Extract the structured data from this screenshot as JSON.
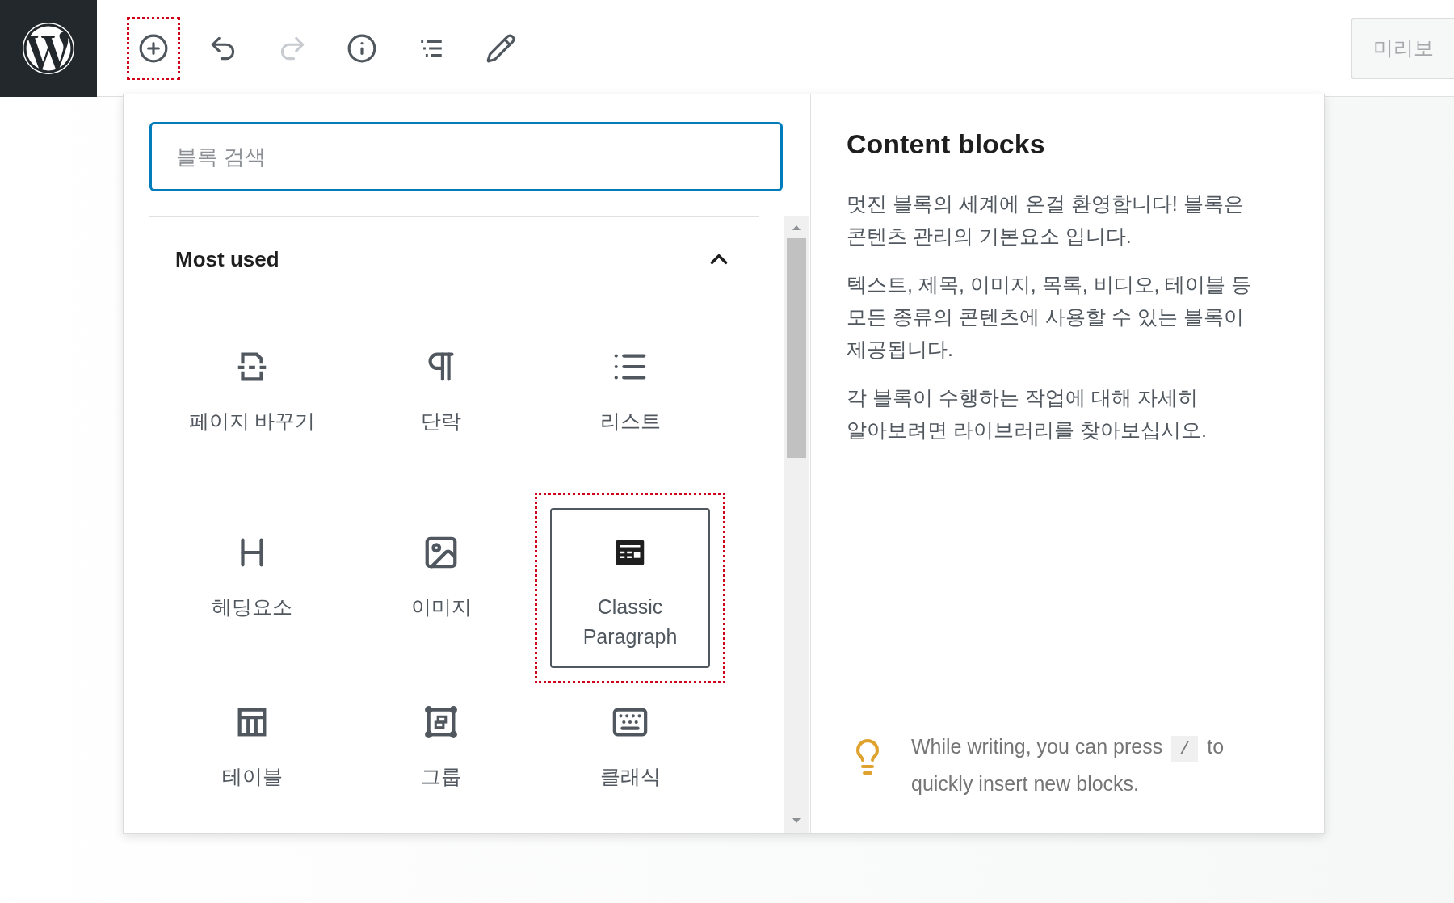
{
  "toolbar": {
    "buttons": [
      {
        "kind": "inserter",
        "disabled": false,
        "highlighted": true
      },
      {
        "kind": "undo",
        "disabled": false,
        "highlighted": false
      },
      {
        "kind": "redo",
        "disabled": true,
        "highlighted": false
      },
      {
        "kind": "info",
        "disabled": false,
        "highlighted": false
      },
      {
        "kind": "outline",
        "disabled": false,
        "highlighted": false
      },
      {
        "kind": "tools",
        "disabled": false,
        "highlighted": false
      }
    ],
    "preview_button": "미리보"
  },
  "inserter": {
    "search": {
      "placeholder": "블록 검색"
    },
    "section": {
      "title": "Most used",
      "expanded": true
    },
    "blocks": [
      {
        "kind": "page-break",
        "label": "페이지 바꾸기",
        "selected": false,
        "highlighted": false
      },
      {
        "kind": "paragraph",
        "label": "단락",
        "selected": false,
        "highlighted": false
      },
      {
        "kind": "list",
        "label": "리스트",
        "selected": false,
        "highlighted": false
      },
      {
        "kind": "heading",
        "label": "헤딩요소",
        "selected": false,
        "highlighted": false
      },
      {
        "kind": "image",
        "label": "이미지",
        "selected": false,
        "highlighted": false
      },
      {
        "kind": "classic-paragraph",
        "label": "Classic Paragraph",
        "selected": true,
        "highlighted": true
      },
      {
        "kind": "table",
        "label": "테이블",
        "selected": false,
        "highlighted": false
      },
      {
        "kind": "group",
        "label": "그룹",
        "selected": false,
        "highlighted": false
      },
      {
        "kind": "classic",
        "label": "클래식",
        "selected": false,
        "highlighted": false
      }
    ]
  },
  "help": {
    "title": "Content blocks",
    "paragraphs": [
      "멋진 블록의 세계에 온걸 환영합니다! 블록은 콘텐츠 관리의 기본요소 입니다.",
      "텍스트, 제목, 이미지, 목록, 비디오, 테이블 등 모든 종류의 콘텐츠에 사용할 수 있는 블록이 제공됩니다.",
      "각 블록이 수행하는 작업에 대해 자세히 알아보려면 라이브러리를 찾아보십시오."
    ],
    "tip": {
      "before": "While writing, you can press",
      "key": "/",
      "after": "to quickly insert new blocks."
    }
  }
}
